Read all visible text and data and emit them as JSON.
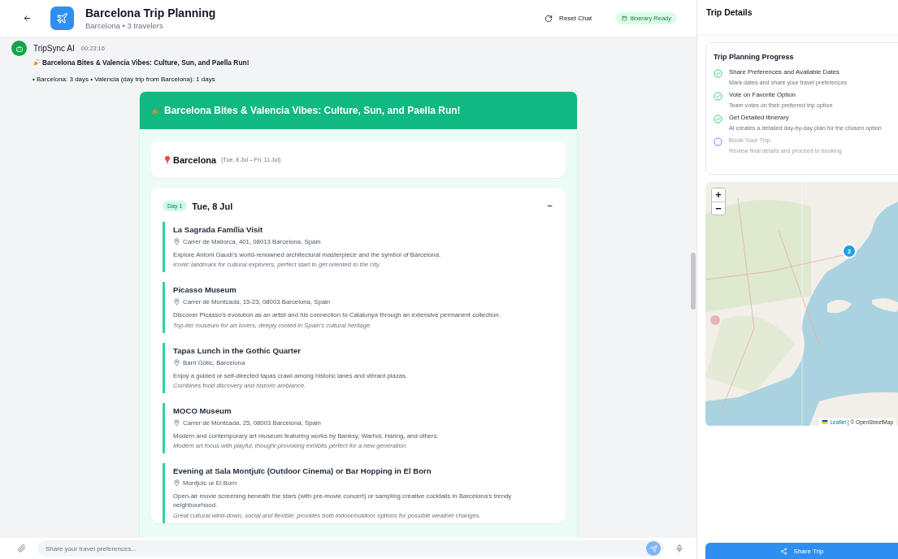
{
  "header": {
    "title": "Barcelona Trip Planning",
    "subtitle": "Barcelona • 3 travelers",
    "reset_label": "Reset Chat",
    "status_badge": "Itinerary Ready"
  },
  "message": {
    "sender": "TripSync AI",
    "time": "00:23:16",
    "headline": "Barcelona Bites & Valencia Vibes: Culture, Sun, and Paella Run!",
    "summary": "• Barcelona: 3 days • Valencia (day trip from Barcelona): 1 days"
  },
  "itinerary": {
    "title": "Barcelona Bites & Valencia Vibes: Culture, Sun, and Paella Run!",
    "city": {
      "name": "Barcelona",
      "dates": "(Tue, 8 Jul – Fri, 11 Jul)"
    },
    "days": [
      {
        "badge": "Day 1",
        "date": "Tue, 8 Jul",
        "expanded": true,
        "activities": [
          {
            "name": "La Sagrada Família Visit",
            "address": "Carrer de Mallorca, 401, 08013 Barcelona, Spain",
            "description": "Explore Antoni Gaudí's world-renowned architectural masterpiece and the symbol of Barcelona.",
            "note": "Iconic landmark for cultural explorers, perfect start to get oriented to the city."
          },
          {
            "name": "Picasso Museum",
            "address": "Carrer de Montcada, 15-23, 08003 Barcelona, Spain",
            "description": "Discover Picasso's evolution as an artist and his connection to Catalunya through an extensive permanent collection.",
            "note": "Top-tier museum for art lovers, deeply rooted in Spain's cultural heritage."
          },
          {
            "name": "Tapas Lunch in the Gothic Quarter",
            "address": "Barri Gòtic, Barcelona",
            "description": "Enjoy a guided or self-directed tapas crawl among historic lanes and vibrant plazas.",
            "note": "Combines food discovery and historic ambiance."
          },
          {
            "name": "MOCO Museum",
            "address": "Carrer de Montcada, 25, 08003 Barcelona, Spain",
            "description": "Modern and contemporary art museum featuring works by Banksy, Warhol, Haring, and others.",
            "note": "Modern art focus with playful, thought-provoking exhibits perfect for a new generation."
          },
          {
            "name": "Evening at Sala Montjuïc (Outdoor Cinema) or Bar Hopping in El Born",
            "address": "Montjuïc or El Born",
            "description": "Open-air movie screening beneath the stars (with pre-movie concert) or sampling creative cocktails in Barcelona's trendy neighbourhood.",
            "note": "Great cultural wind-down, social and flexible; provides both indoor/outdoor options for possible weather changes."
          }
        ]
      }
    ]
  },
  "input": {
    "placeholder": "Share your travel preferences..."
  },
  "sidebar": {
    "title": "Trip Details",
    "progress": {
      "title": "Trip Planning Progress",
      "steps": [
        {
          "title": "Share Preferences and Available Dates",
          "description": "Mark dates and share your travel preferences",
          "done": true
        },
        {
          "title": "Vote on Favorite Option",
          "description": "Team votes on their preferred trip option",
          "done": true
        },
        {
          "title": "Get Detailed Itinerary",
          "description": "AI creates a detailed day-by-day plan for the chosen option",
          "done": true
        },
        {
          "title": "Book Your Trip",
          "description": "Review final details and proceed to booking",
          "done": false
        }
      ]
    },
    "map": {
      "kind": "picture",
      "zoom_in": "+",
      "zoom_out": "−",
      "cluster_count": "2",
      "attribution_link": "Leaflet",
      "attribution": "| © OpenStreetMap"
    },
    "share_button": "Share Trip"
  }
}
